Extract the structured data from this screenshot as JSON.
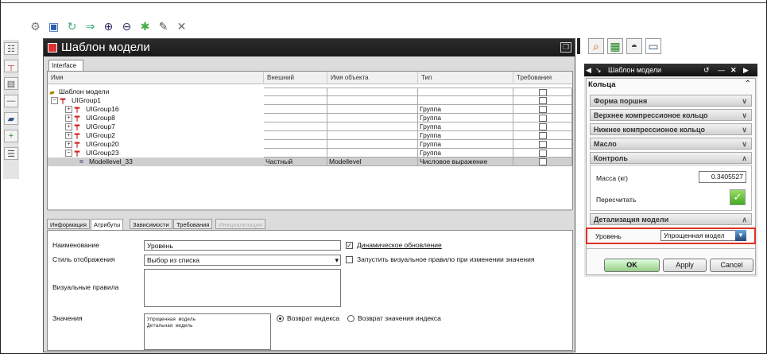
{
  "window": {
    "title": "Шаблон модели",
    "tab": "Interface"
  },
  "grid": {
    "columns": [
      "Имя",
      "Внешний",
      "Имя объекта",
      "Тип",
      "Требования"
    ],
    "rows": [
      {
        "name": "Шаблон модели",
        "external": "",
        "object": "",
        "type": ""
      },
      {
        "name": "UIGroup1",
        "external": "",
        "object": "",
        "type": ""
      },
      {
        "name": "UIGroup16",
        "external": "",
        "object": "",
        "type": "Группа"
      },
      {
        "name": "UIGroup8",
        "external": "",
        "object": "",
        "type": "Группа"
      },
      {
        "name": "UIGroup7",
        "external": "",
        "object": "",
        "type": "Группа"
      },
      {
        "name": "UIGroup2",
        "external": "",
        "object": "",
        "type": "Группа"
      },
      {
        "name": "UIGroup20",
        "external": "",
        "object": "",
        "type": "Группа"
      },
      {
        "name": "UIGroup23",
        "external": "",
        "object": "",
        "type": "Группа"
      },
      {
        "name": "Modellevel_33",
        "external": "Частный",
        "object": "Modellevel",
        "type": "Числовое выражение"
      }
    ]
  },
  "lower_tabs": [
    "Информация",
    "Атрибуты",
    "Зависимости",
    "Требования",
    "Инициализация"
  ],
  "attributes": {
    "name_label": "Наименование",
    "name_value": "Уровень",
    "display_style_label": "Стиль отображения",
    "display_style_value": "Выбор из списка",
    "visual_rules_label": "Визуальные правила",
    "values_label": "Значения",
    "values_list": [
      "Упрощенная модель",
      "Детальная модель"
    ],
    "dynamic_update": "Динамическое обновление",
    "run_visual_rule": "Запустить визуальное правило при изменении значения",
    "return_index": "Возврат индекса",
    "return_index_value": "Возврат значения индекса"
  },
  "right_panel": {
    "title": "Шаблон модели",
    "header": "Кольца",
    "sections": [
      "Форма поршня",
      "Верхнее компрессионое кольцо",
      "Нижнее компрессионое кольцо",
      "Масло",
      "Контроль"
    ],
    "mass_label": "Масса (кг)",
    "mass_value": "0.3405527",
    "recalc_label": "Пересчитать",
    "detail_section": "Детализация модели",
    "level_label": "Уровень",
    "level_value": "Упрощенная модел",
    "ok": "OK",
    "apply": "Apply",
    "cancel": "Cancel"
  },
  "colors": {
    "highlight": "#e03020",
    "title_bar": "#1a1a1a"
  }
}
